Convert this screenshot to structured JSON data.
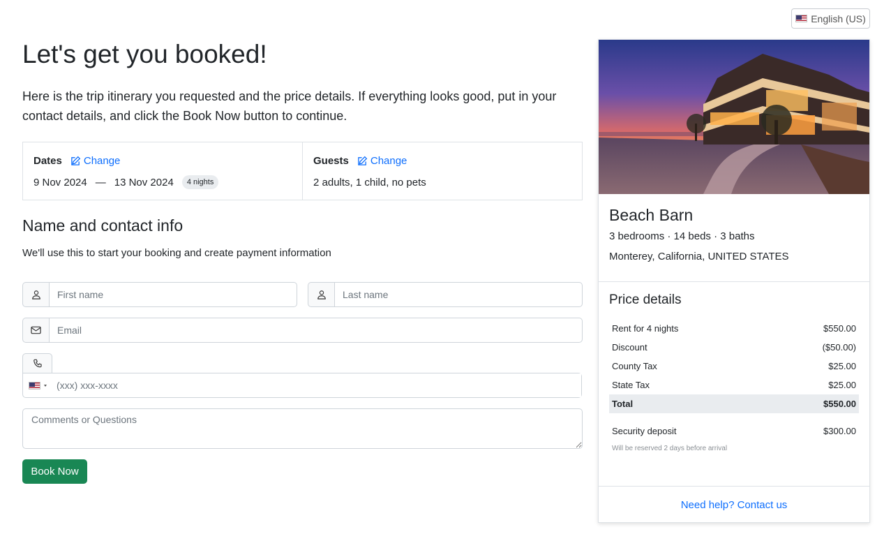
{
  "language": {
    "label": "English (US)",
    "flag_icon": "us-flag-icon"
  },
  "header": {
    "title": "Let's get you booked!",
    "intro": "Here is the trip itinerary you requested and the price details. If everything looks good, put in your contact details, and click the Book Now button to continue."
  },
  "trip": {
    "dates_label": "Dates",
    "change_label": "Change",
    "check_in": "9 Nov 2024",
    "separator": "—",
    "check_out": "13 Nov 2024",
    "nights_badge": "4 nights",
    "guests_label": "Guests",
    "guests_value": "2 adults, 1 child, no pets"
  },
  "contact": {
    "title": "Name and contact info",
    "subtitle": "We'll use this to start your booking and create payment information",
    "first_name_placeholder": "First name",
    "last_name_placeholder": "Last name",
    "email_placeholder": "Email",
    "phone_placeholder": "(xxx) xxx-xxxx",
    "comments_placeholder": "Comments or Questions",
    "book_button": "Book Now"
  },
  "property": {
    "name": "Beach Barn",
    "meta": "3 bedrooms · 14 beds · 3 baths",
    "location": "Monterey, California, UNITED STATES"
  },
  "price": {
    "title": "Price details",
    "rows": [
      {
        "label": "Rent for 4 nights",
        "amount": "$550.00"
      },
      {
        "label": "Discount",
        "amount": "($50.00)"
      },
      {
        "label": "County Tax",
        "amount": "$25.00"
      },
      {
        "label": "State Tax",
        "amount": "$25.00"
      }
    ],
    "total_label": "Total",
    "total_amount": "$550.00",
    "deposit_label": "Security deposit",
    "deposit_amount": "$300.00",
    "deposit_note": "Will be reserved 2 days before arrival"
  },
  "help_link": "Need help? Contact us",
  "colors": {
    "primary_link": "#0d6efd",
    "book_button": "#198754",
    "total_bg": "#e9ecef"
  }
}
